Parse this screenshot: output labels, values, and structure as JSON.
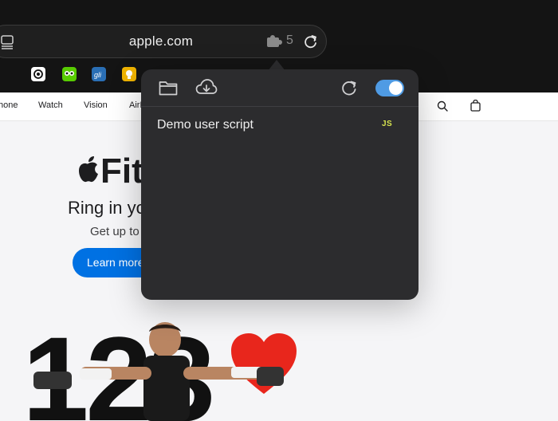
{
  "browser": {
    "url": "apple.com",
    "extension_count": "5",
    "favorites": [
      {
        "name": "chatgpt-favicon"
      },
      {
        "name": "duolingo-favicon"
      },
      {
        "name": "gli-favicon",
        "text": "gli"
      },
      {
        "name": "yellow-favicon"
      }
    ]
  },
  "nav": {
    "items": [
      "hone",
      "Watch",
      "Vision",
      "AirP"
    ]
  },
  "hero": {
    "title": "Fit",
    "heading": "Ring in yo",
    "subtitle": "Get up to",
    "cta": "Learn more",
    "big_number": "123"
  },
  "popover": {
    "scripts": [
      {
        "name": "Demo user script",
        "type": "JS"
      }
    ],
    "enabled": true
  },
  "colors": {
    "accent": "#4f9be4",
    "cta": "#0071e3",
    "script_type": "#d7e34f",
    "heart": "#e8261c"
  }
}
